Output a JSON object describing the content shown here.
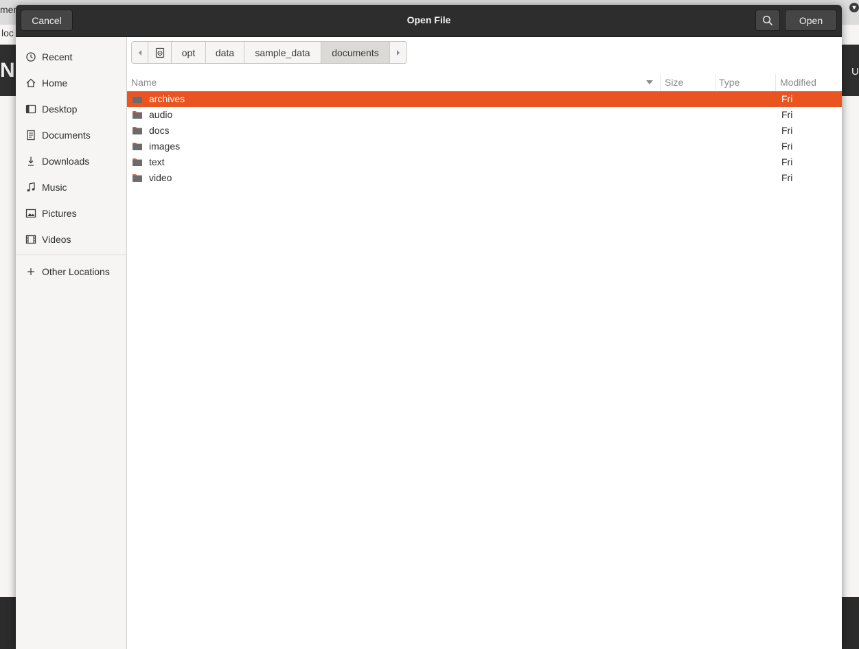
{
  "background": {
    "fragments": [
      "men",
      "loc",
      "N",
      "U"
    ]
  },
  "dialog": {
    "title": "Open File",
    "cancel_label": "Cancel",
    "open_label": "Open",
    "search_icon": "search-icon"
  },
  "sidebar": {
    "items": [
      {
        "label": "Recent",
        "icon": "clock-icon"
      },
      {
        "label": "Home",
        "icon": "home-icon"
      },
      {
        "label": "Desktop",
        "icon": "desktop-icon"
      },
      {
        "label": "Documents",
        "icon": "document-icon"
      },
      {
        "label": "Downloads",
        "icon": "download-icon"
      },
      {
        "label": "Music",
        "icon": "music-icon"
      },
      {
        "label": "Pictures",
        "icon": "picture-icon"
      },
      {
        "label": "Videos",
        "icon": "video-icon"
      }
    ],
    "other_locations": {
      "label": "Other Locations",
      "icon": "plus-icon"
    }
  },
  "pathbar": {
    "segments": [
      "opt",
      "data",
      "sample_data",
      "documents"
    ],
    "active": "documents"
  },
  "columns": {
    "name": "Name",
    "size": "Size",
    "type": "Type",
    "modified": "Modified"
  },
  "files": [
    {
      "name": "archives",
      "modified": "Fri",
      "selected": true
    },
    {
      "name": "audio",
      "modified": "Fri",
      "selected": false
    },
    {
      "name": "docs",
      "modified": "Fri",
      "selected": false
    },
    {
      "name": "images",
      "modified": "Fri",
      "selected": false
    },
    {
      "name": "text",
      "modified": "Fri",
      "selected": false
    },
    {
      "name": "video",
      "modified": "Fri",
      "selected": false
    }
  ],
  "colors": {
    "accent": "#e95420",
    "headerbar": "#2d2d2d",
    "folder": "#6b6b6b",
    "folder_tab": "#e05a3a"
  }
}
